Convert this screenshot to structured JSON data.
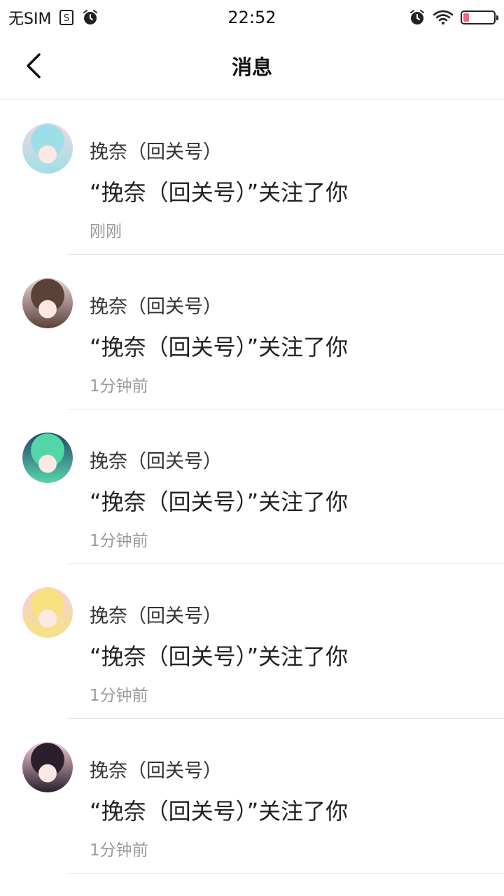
{
  "status_bar": {
    "carrier": "无SIM",
    "time": "22:52",
    "battery_level": 0.2,
    "icons": [
      "sim-icon",
      "alarm-icon",
      "wifi-icon",
      "battery-icon"
    ]
  },
  "nav": {
    "back_icon": "chevron-left-icon",
    "title": "消息"
  },
  "messages": [
    {
      "name": "挽奈（回关号）",
      "text": "“挽奈（回关号）”关注了你",
      "time": "刚刚",
      "avatar_colors": [
        "#9ddfe6",
        "#f4d6de"
      ]
    },
    {
      "name": "挽奈（回关号）",
      "text": "“挽奈（回关号）”关注了你",
      "time": "1分钟前",
      "avatar_colors": [
        "#5a4238",
        "#e9d2dc"
      ]
    },
    {
      "name": "挽奈（回关号）",
      "text": "“挽奈（回关号）”关注了你",
      "time": "1分钟前",
      "avatar_colors": [
        "#53d7a9",
        "#2c3e6b"
      ]
    },
    {
      "name": "挽奈（回关号）",
      "text": "“挽奈（回关号）”关注了你",
      "time": "1分钟前",
      "avatar_colors": [
        "#f7e27f",
        "#f7cde3"
      ]
    },
    {
      "name": "挽奈（回关号）",
      "text": "“挽奈（回关号）”关注了你",
      "time": "1分钟前",
      "avatar_colors": [
        "#2a1f2b",
        "#f4c7d7"
      ]
    }
  ]
}
